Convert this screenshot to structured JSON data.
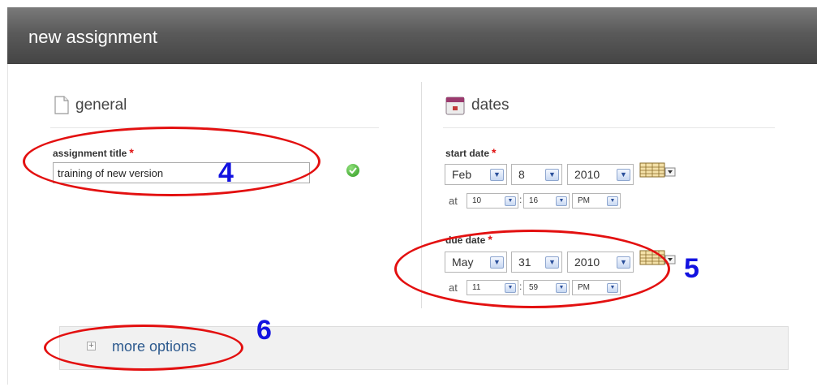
{
  "header": {
    "title": "new assignment"
  },
  "general": {
    "heading": "general",
    "assignment_title": {
      "label": "assignment title",
      "required_mark": "*",
      "value": "training of new version"
    }
  },
  "dates": {
    "heading": "dates",
    "start": {
      "label": "start date",
      "required_mark": "*",
      "month": "Feb",
      "day": "8",
      "year": "2010",
      "at": "at",
      "hour": "10",
      "minute": "16",
      "ampm": "PM",
      "separator": ":"
    },
    "due": {
      "label": "due date",
      "required_mark": "*",
      "month": "May",
      "day": "31",
      "year": "2010",
      "at": "at",
      "hour": "11",
      "minute": "59",
      "ampm": "PM",
      "separator": ":"
    }
  },
  "more_options": {
    "expand_symbol": "+",
    "label": "more options"
  },
  "annotations": {
    "n4": "4",
    "n5": "5",
    "n6": "6"
  },
  "icons": {
    "general": "document-icon",
    "dates": "calendar-icon",
    "valid": "checkmark-icon",
    "date_picker": "calendar-picker-icon",
    "dropdown": "chevron-down-icon"
  },
  "colors": {
    "header_bg": "#555555",
    "link": "#2d5a8e",
    "required": "#e01010",
    "annotation_ellipse": "#e31010",
    "annotation_number": "#1212e0"
  }
}
